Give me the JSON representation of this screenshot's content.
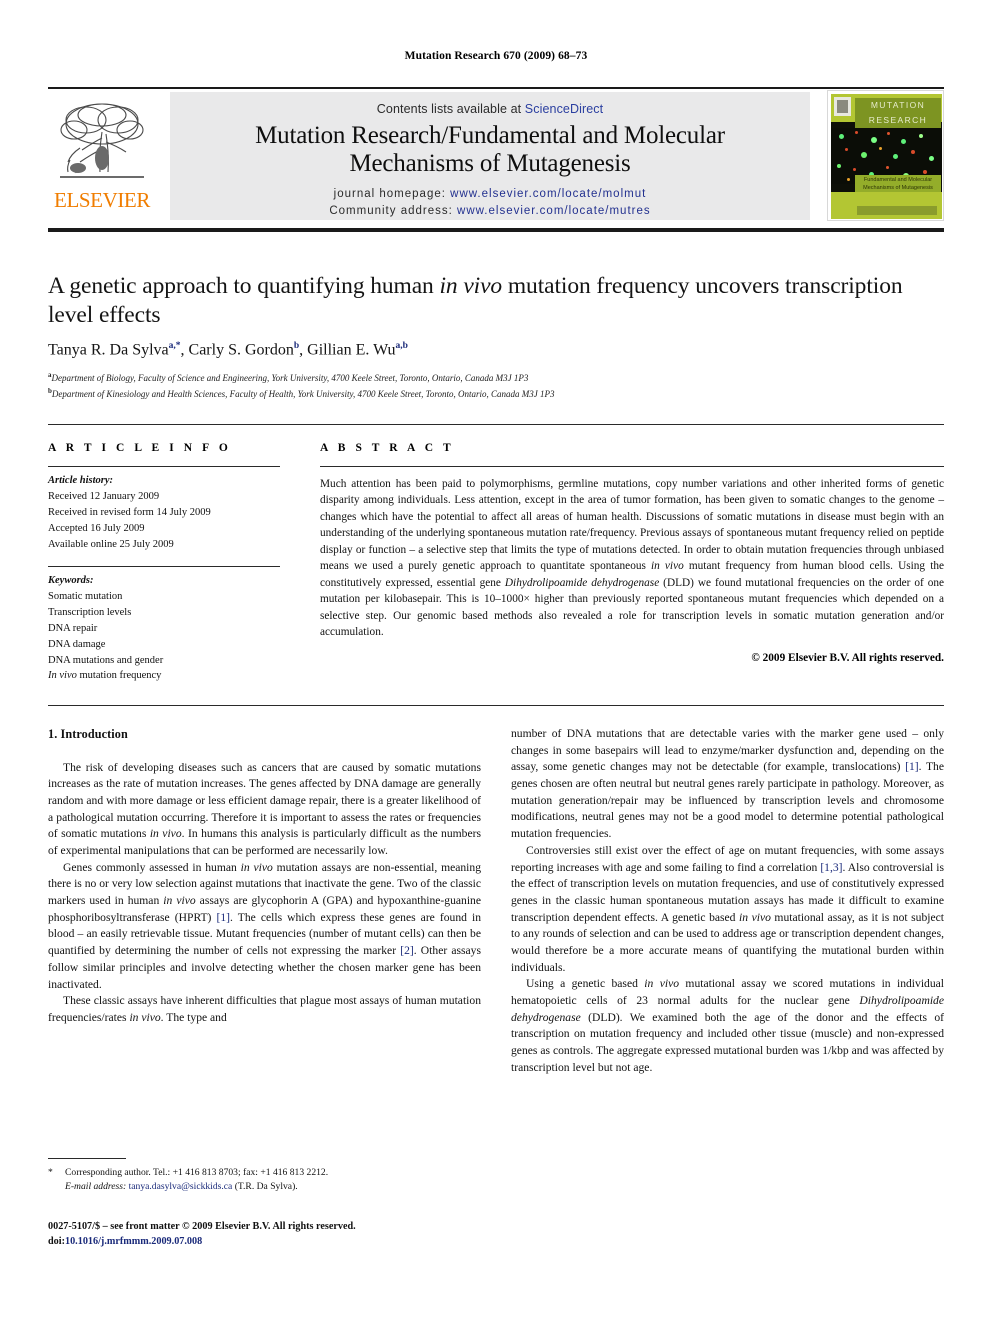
{
  "running_head": "Mutation Research 670 (2009) 68–73",
  "banner": {
    "contents_prefix": "Contents lists available at ",
    "contents_link": "ScienceDirect",
    "journal_title_line1": "Mutation Research/Fundamental and Molecular",
    "journal_title_line2": "Mechanisms of Mutagenesis",
    "homepage_label": "journal homepage:",
    "homepage_url": "www.elsevier.com/locate/molmut",
    "community_label": "Community address:",
    "community_url": "www.elsevier.com/locate/mutres",
    "publisher_logo_word": "ELSEVIER",
    "cover_title_line1": "MUTATION",
    "cover_title_line2": "RESEARCH",
    "cover_subtitle_line1": "Fundamental and Molecular",
    "cover_subtitle_line2": "Mechanisms of Mutagenesis",
    "accent_orange": "#f07d00",
    "link_blue": "#22308f",
    "cover_green": "#b3c633"
  },
  "article": {
    "title_part1": "A genetic approach to quantifying human ",
    "title_italic": "in vivo",
    "title_part2": " mutation frequency uncovers transcription level effects",
    "authors": [
      {
        "name": "Tanya R. Da Sylva",
        "sup": "a,*"
      },
      {
        "name": "Carly S. Gordon",
        "sup": "b"
      },
      {
        "name": "Gillian E. Wu",
        "sup": "a,b"
      }
    ],
    "affiliations": [
      {
        "mark": "a",
        "text": "Department of Biology, Faculty of Science and Engineering, York University, 4700 Keele Street, Toronto, Ontario, Canada M3J 1P3"
      },
      {
        "mark": "b",
        "text": "Department of Kinesiology and Health Sciences, Faculty of Health, York University, 4700 Keele Street, Toronto, Ontario, Canada M3J 1P3"
      }
    ]
  },
  "article_info": {
    "heading": "A R T I C L E   I N F O",
    "history_label": "Article history:",
    "history": [
      "Received 12 January 2009",
      "Received in revised form 14 July 2009",
      "Accepted 16 July 2009",
      "Available online 25 July 2009"
    ],
    "keywords_label": "Keywords:",
    "keywords": [
      "Somatic mutation",
      "Transcription levels",
      "DNA repair",
      "DNA damage",
      "DNA mutations and gender"
    ],
    "keyword_italic_last": "In vivo",
    "keyword_last_rest": " mutation frequency"
  },
  "abstract": {
    "heading": "A B S T R A C T",
    "p1_a": "Much attention has been paid to polymorphisms, germline mutations, copy number variations and other inherited forms of genetic disparity among individuals. Less attention, except in the area of tumor formation, has been given to somatic changes to the genome – changes which have the potential to affect all areas of human health. Discussions of somatic mutations in disease must begin with an understanding of the underlying spontaneous mutation rate/frequency. Previous assays of spontaneous mutant frequency relied on peptide display or function – a selective step that limits the type of mutations detected. In order to obtain mutation frequencies through unbiased means we used a purely genetic approach to quantitate spontaneous ",
    "p1_it1": "in vivo",
    "p1_b": " mutant frequency from human blood cells. Using the constitutively expressed, essential gene ",
    "p1_it2": "Dihydrolipoamide dehydrogenase",
    "p1_c": " (DLD) we found mutational frequencies on the order of one mutation per kilobasepair. This is 10–1000× higher than previously reported spontaneous mutant frequencies which depended on a selective step. Our genomic based methods also revealed a role for transcription levels in somatic mutation generation and/or accumulation.",
    "copyright": "© 2009 Elsevier B.V. All rights reserved."
  },
  "body": {
    "section_heading": "1. Introduction",
    "left": {
      "p1": "The risk of developing diseases such as cancers that are caused by somatic mutations increases as the rate of mutation increases. The genes affected by DNA damage are generally random and with more damage or less efficient damage repair, there is a greater likelihood of a pathological mutation occurring. Therefore it is important to assess the rates or frequencies of somatic mutations ",
      "p1_it": "in vivo",
      "p1_b": ". In humans this analysis is particularly difficult as the numbers of experimental manipulations that can be performed are necessarily low.",
      "p2_a": "Genes commonly assessed in human ",
      "p2_it1": "in vivo",
      "p2_b": " mutation assays are non-essential, meaning there is no or very low selection against mutations that inactivate the gene. Two of the classic markers used in human ",
      "p2_it2": "in vivo",
      "p2_c": " assays are glycophorin A (GPA) and hypoxanthine-guanine phosphoribosyltransferase (HPRT) ",
      "p2_ref1": "[1]",
      "p2_d": ". The cells which express these genes are found in blood – an easily retrievable tissue. Mutant frequencies (number of mutant cells) can then be quantified by determining the number of cells not expressing the marker ",
      "p2_ref2": "[2]",
      "p2_e": ". Other assays follow similar principles and involve detecting whether the chosen marker gene has been inactivated.",
      "p3_a": "These classic assays have inherent difficulties that plague most assays of human mutation frequencies/rates ",
      "p3_it": "in vivo",
      "p3_b": ". The type and"
    },
    "right": {
      "p1_a": "number of DNA mutations that are detectable varies with the marker gene used – only changes in some basepairs will lead to enzyme/marker dysfunction and, depending on the assay, some genetic changes may not be detectable (for example, translocations) ",
      "p1_ref": "[1]",
      "p1_b": ". The genes chosen are often neutral but neutral genes rarely participate in pathology. Moreover, as mutation generation/repair may be influenced by transcription levels and chromosome modifications, neutral genes may not be a good model to determine potential pathological mutation frequencies.",
      "p2_a": "Controversies still exist over the effect of age on mutant frequencies, with some assays reporting increases with age and some failing to find a correlation ",
      "p2_ref": "[1,3]",
      "p2_b": ". Also controversial is the effect of transcription levels on mutation frequencies, and use of constitutively expressed genes in the classic human spontaneous mutation assays has made it difficult to examine transcription dependent effects. A genetic based ",
      "p2_it1": "in vivo",
      "p2_c": " mutational assay, as it is not subject to any rounds of selection and can be used to address age or transcription dependent changes, would therefore be a more accurate means of quantifying the mutational burden within individuals.",
      "p3_a": "Using a genetic based ",
      "p3_it1": "in vivo",
      "p3_b": " mutational assay we scored mutations in individual hematopoietic cells of 23 normal adults for the nuclear gene ",
      "p3_it2": "Dihydrolipoamide dehydrogenase",
      "p3_c": " (DLD). We examined both the age of the donor and the effects of transcription on mutation frequency and included other tissue (muscle) and non-expressed genes as controls. The aggregate expressed mutational burden was 1/kbp and was affected by transcription level but not age."
    }
  },
  "footer": {
    "star": "*",
    "corresponding": "Corresponding author. Tel.: +1 416 813 8703; fax: +1 416 813 2212.",
    "email_label": "E-mail address:",
    "email": "tanya.dasylva@sickkids.ca",
    "email_attrib": " (T.R. Da Sylva).",
    "imprint": "0027-5107/$ – see front matter © 2009 Elsevier B.V. All rights reserved.",
    "doi_label": "doi:",
    "doi": "10.1016/j.mrfmmm.2009.07.008"
  }
}
